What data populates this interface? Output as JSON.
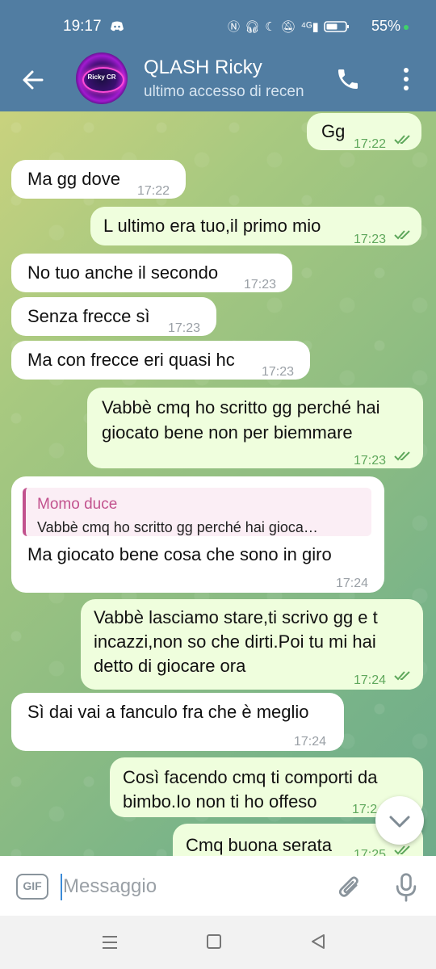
{
  "status_bar": {
    "time": "19:17",
    "icons": [
      "discord-icon",
      "nfc-icon",
      "headphones-icon",
      "moon-icon",
      "mute-icon",
      "4g-signal-icon",
      "battery-icon"
    ],
    "battery": "55%"
  },
  "header": {
    "title": "QLASH Ricky",
    "subtitle": "ultimo accesso di recen",
    "avatar_text": "Ricky CR",
    "bar_color": "#517da2"
  },
  "messages": [
    {
      "dir": "out",
      "text": "Gg",
      "time": "17:22",
      "read": true
    },
    {
      "dir": "in",
      "text": "Ma gg dove",
      "time": "17:22"
    },
    {
      "dir": "out",
      "text": "L ultimo era tuo,il primo mio",
      "time": "17:23",
      "read": true
    },
    {
      "dir": "in",
      "text": "No tuo anche il secondo",
      "time": "17:23"
    },
    {
      "dir": "in",
      "text": "Senza frecce sì",
      "time": "17:23"
    },
    {
      "dir": "in",
      "text": "Ma con frecce eri quasi hc",
      "time": "17:23"
    },
    {
      "dir": "out",
      "lines": [
        "Vabbè cmq ho scritto gg perché hai",
        "giocato bene non per biemmare"
      ],
      "time": "17:23",
      "read": true
    },
    {
      "dir": "in",
      "reply_name": "Momo duce",
      "reply_text": "Vabbè cmq ho scritto gg perché hai gioca…",
      "text": "Ma giocato bene cosa che sono in giro",
      "time": "17:24"
    },
    {
      "dir": "out",
      "lines": [
        "Vabbè lasciamo stare,ti scrivo gg e t",
        "incazzi,non so che dirti.Poi tu mi hai",
        "detto di giocare ora"
      ],
      "time": "17:24",
      "read": true
    },
    {
      "dir": "in",
      "text": "Sì dai vai a fanculo fra che è meglio",
      "time": "17:24"
    },
    {
      "dir": "out",
      "lines": [
        "Così facendo cmq ti comporti da",
        "bimbo.Io non ti ho offeso"
      ],
      "time": "17:2",
      "read": true
    },
    {
      "dir": "out",
      "text": "Cmq buona serata",
      "time": "17:25",
      "read": true
    }
  ],
  "composer": {
    "gif_label": "GIF",
    "placeholder": "Messaggio"
  },
  "colors": {
    "incoming_bubble": "#ffffff",
    "outgoing_bubble": "#effedd",
    "time_outgoing": "#5fa85c",
    "reply_accent": "#c2528e"
  }
}
